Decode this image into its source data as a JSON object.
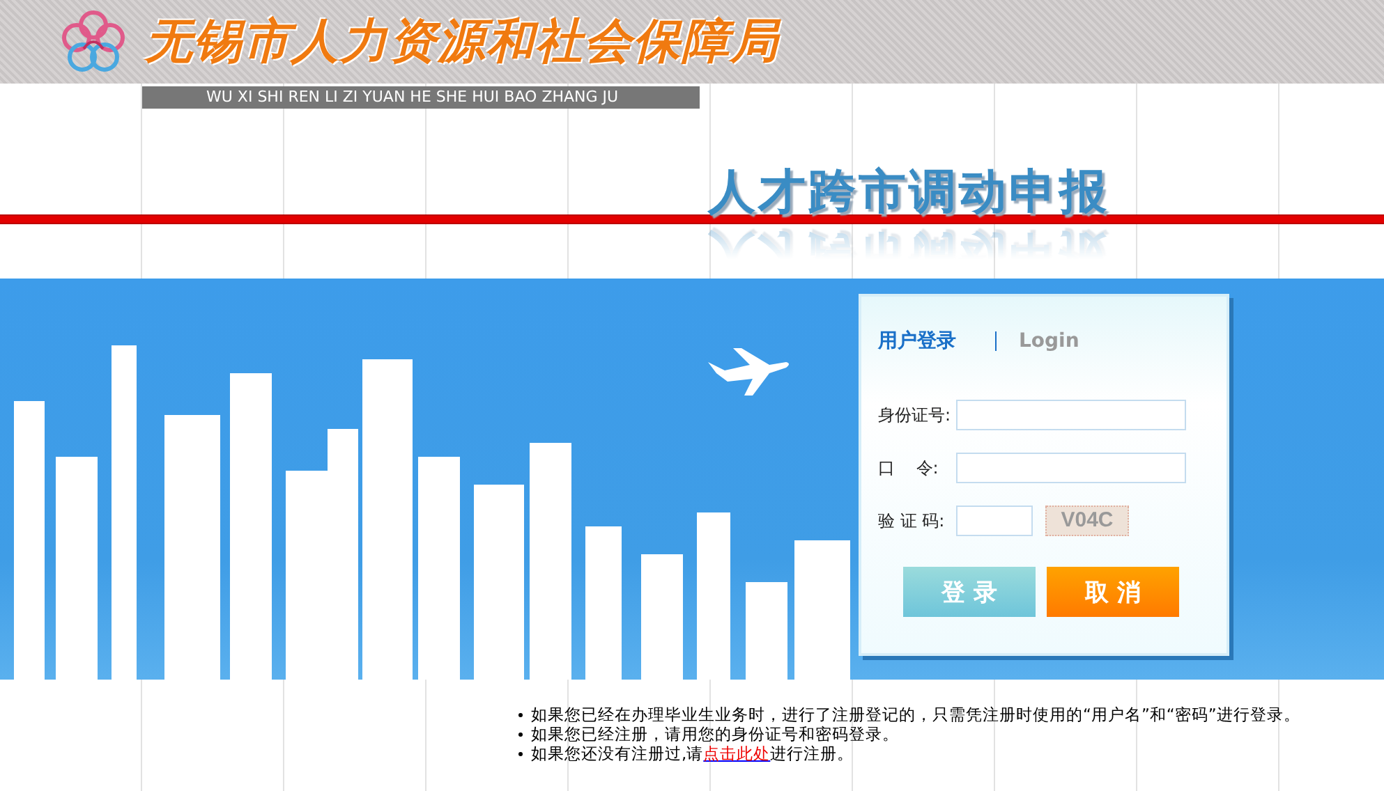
{
  "header": {
    "title": "无锡市人力资源和社会保障局",
    "pinyin": "WU XI SHI REN LI ZI YUAN HE SHE HUI BAO ZHANG JU"
  },
  "page_title": "人才跨市调动申报",
  "login": {
    "title": "用户登录",
    "subtitle": "Login",
    "fields": [
      {
        "kind": "text",
        "label": "身份证号:"
      },
      {
        "kind": "password",
        "label": "口    令:"
      },
      {
        "kind": "captcha",
        "label": "验 证 码:",
        "captcha": "V04C"
      }
    ],
    "buttons": [
      {
        "kind": "submit",
        "label": "登 录"
      },
      {
        "kind": "cancel",
        "label": "取 消"
      }
    ]
  },
  "notes": [
    {
      "text": "如果您已经在办理毕业生业务时，进行了注册登记的，只需凭注册时使用的“用户名”和“密码”进行登录。"
    },
    {
      "text": "如果您已经注册，请用您的身份证号和密码登录。"
    },
    {
      "text": "如果您还没有注册过,请",
      "link": "点击此处",
      "after": "进行注册。"
    }
  ]
}
